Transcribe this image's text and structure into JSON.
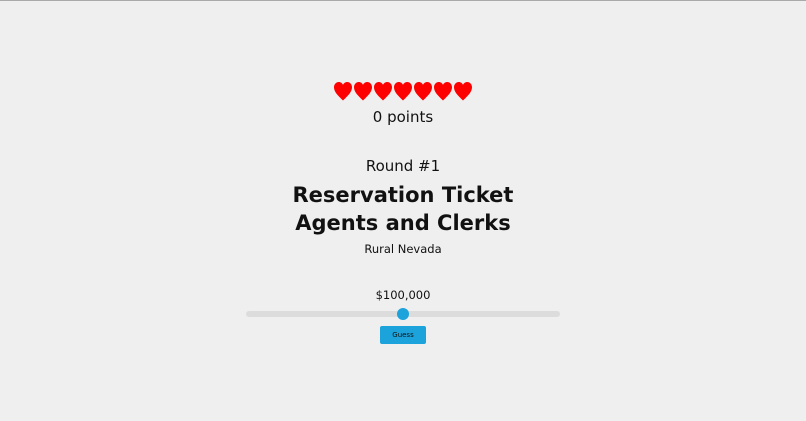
{
  "game": {
    "lives": {
      "count": 7,
      "icon": "heart-icon",
      "color": "#ff0000"
    },
    "points_text": "0 points",
    "round_text": "Round #1",
    "job_title": "Reservation Ticket Agents and Clerks",
    "location": "Rural Nevada",
    "guess": {
      "value_text": "$100,000",
      "slider_fraction": 0.5,
      "button_label": "Guess"
    },
    "colors": {
      "background": "#efefef",
      "accent": "#1ca3dc",
      "track": "#dcdcdc",
      "heart": "#ff0000"
    }
  }
}
